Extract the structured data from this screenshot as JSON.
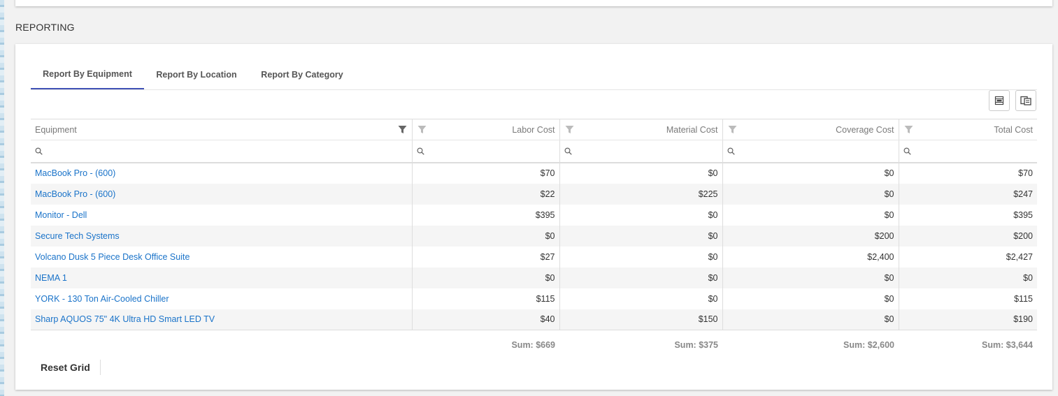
{
  "section_title": "REPORTING",
  "tabs": [
    {
      "label": "Report By Equipment",
      "active": true
    },
    {
      "label": "Report By Location",
      "active": false
    },
    {
      "label": "Report By Category",
      "active": false
    }
  ],
  "toolbar": {
    "export_excel_icon": "xlsx-export-icon",
    "column_chooser_icon": "column-chooser-icon"
  },
  "grid": {
    "columns": [
      "Equipment",
      "Labor Cost",
      "Material Cost",
      "Coverage Cost",
      "Total Cost"
    ],
    "search_icon": "search-icon",
    "filter_icon": "filter-icon",
    "rows": [
      {
        "equipment": "MacBook Pro - (600)",
        "labor": "$70",
        "material": "$0",
        "coverage": "$0",
        "total": "$70"
      },
      {
        "equipment": "MacBook Pro - (600)",
        "labor": "$22",
        "material": "$225",
        "coverage": "$0",
        "total": "$247"
      },
      {
        "equipment": "Monitor - Dell",
        "labor": "$395",
        "material": "$0",
        "coverage": "$0",
        "total": "$395"
      },
      {
        "equipment": "Secure Tech Systems",
        "labor": "$0",
        "material": "$0",
        "coverage": "$200",
        "total": "$200"
      },
      {
        "equipment": "Volcano Dusk 5 Piece Desk Office Suite",
        "labor": "$27",
        "material": "$0",
        "coverage": "$2,400",
        "total": "$2,427"
      },
      {
        "equipment": "NEMA 1",
        "labor": "$0",
        "material": "$0",
        "coverage": "$0",
        "total": "$0"
      },
      {
        "equipment": "YORK - 130 Ton Air-Cooled Chiller",
        "labor": "$115",
        "material": "$0",
        "coverage": "$0",
        "total": "$115"
      },
      {
        "equipment": "Sharp AQUOS 75\" 4K Ultra HD Smart LED TV",
        "labor": "$40",
        "material": "$150",
        "coverage": "$0",
        "total": "$190"
      }
    ],
    "sums": {
      "labor": "Sum: $669",
      "material": "Sum: $375",
      "coverage": "Sum: $2,600",
      "total": "Sum: $3,644"
    }
  },
  "reset_label": "Reset Grid",
  "colors": {
    "link": "#1a73c9",
    "tab_indicator": "#3f51b5"
  }
}
